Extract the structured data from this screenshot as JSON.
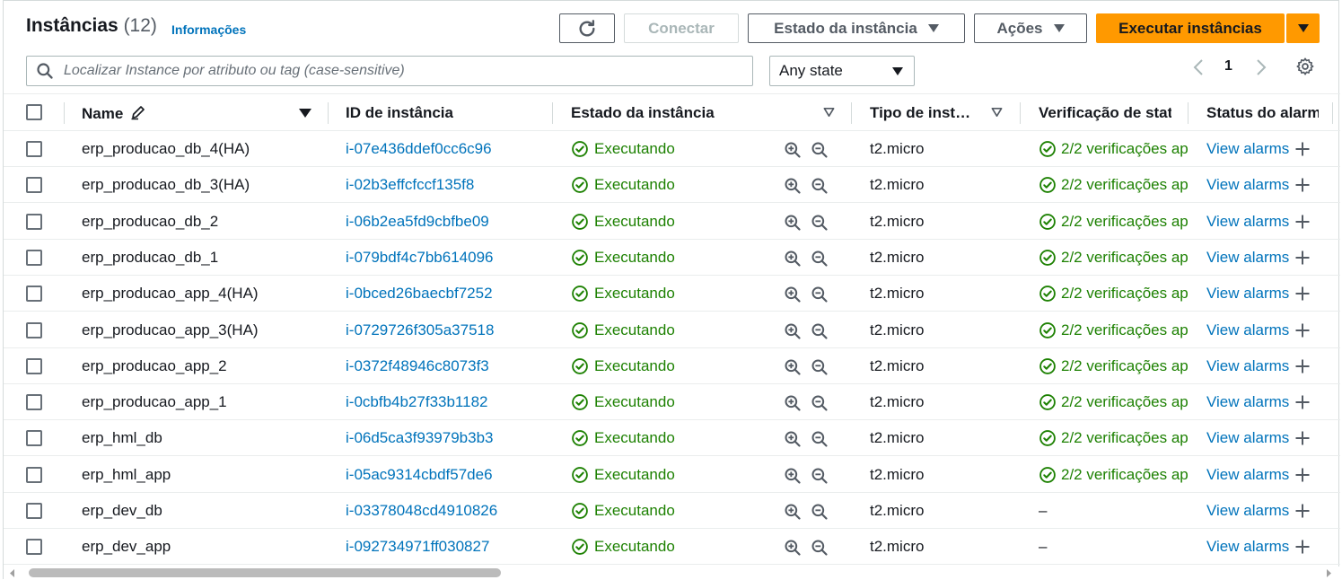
{
  "header": {
    "title": "Instâncias",
    "count": "(12)",
    "info_link": "Informações",
    "connect_label": "Conectar",
    "instance_state_label": "Estado da instância",
    "actions_label": "Ações",
    "launch_label": "Executar instâncias"
  },
  "search": {
    "placeholder": "Localizar Instance por atributo ou tag (case-sensitive)"
  },
  "state_filter": {
    "selected": "Any state"
  },
  "pagination": {
    "current_page": "1"
  },
  "columns": {
    "name": "Name",
    "id": "ID de instância",
    "state": "Estado da instância",
    "type": "Tipo de inst…",
    "check": "Verificação de stat",
    "alarm": "Status do alarm"
  },
  "icons": {
    "refresh": "refresh-icon",
    "search": "search-icon",
    "settings": "gear-icon",
    "edit": "pencil-icon",
    "running": "check-circle-icon",
    "zoom_in": "zoom-in-icon",
    "zoom_out": "zoom-out-icon",
    "add": "plus-icon"
  },
  "colors": {
    "primary": "#ff9900",
    "link": "#0073bb",
    "success": "#1d8102"
  },
  "rows": [
    {
      "name": "erp_producao_db_4(HA)",
      "id": "i-07e436ddef0cc6c96",
      "state": "Executando",
      "type": "t2.micro",
      "check": "2/2 verificações ap",
      "alarm": "View alarms"
    },
    {
      "name": "erp_producao_db_3(HA)",
      "id": "i-02b3effcfccf135f8",
      "state": "Executando",
      "type": "t2.micro",
      "check": "2/2 verificações ap",
      "alarm": "View alarms"
    },
    {
      "name": "erp_producao_db_2",
      "id": "i-06b2ea5fd9cbfbe09",
      "state": "Executando",
      "type": "t2.micro",
      "check": "2/2 verificações ap",
      "alarm": "View alarms"
    },
    {
      "name": "erp_producao_db_1",
      "id": "i-079bdf4c7bb614096",
      "state": "Executando",
      "type": "t2.micro",
      "check": "2/2 verificações ap",
      "alarm": "View alarms"
    },
    {
      "name": "erp_producao_app_4(HA)",
      "id": "i-0bced26baecbf7252",
      "state": "Executando",
      "type": "t2.micro",
      "check": "2/2 verificações ap",
      "alarm": "View alarms"
    },
    {
      "name": "erp_producao_app_3(HA)",
      "id": "i-0729726f305a37518",
      "state": "Executando",
      "type": "t2.micro",
      "check": "2/2 verificações ap",
      "alarm": "View alarms"
    },
    {
      "name": "erp_producao_app_2",
      "id": "i-0372f48946c8073f3",
      "state": "Executando",
      "type": "t2.micro",
      "check": "2/2 verificações ap",
      "alarm": "View alarms"
    },
    {
      "name": "erp_producao_app_1",
      "id": "i-0cbfb4b27f33b1182",
      "state": "Executando",
      "type": "t2.micro",
      "check": "2/2 verificações ap",
      "alarm": "View alarms"
    },
    {
      "name": "erp_hml_db",
      "id": "i-06d5ca3f93979b3b3",
      "state": "Executando",
      "type": "t2.micro",
      "check": "2/2 verificações ap",
      "alarm": "View alarms"
    },
    {
      "name": "erp_hml_app",
      "id": "i-05ac9314cbdf57de6",
      "state": "Executando",
      "type": "t2.micro",
      "check": "2/2 verificações ap",
      "alarm": "View alarms"
    },
    {
      "name": "erp_dev_db",
      "id": "i-03378048cd4910826",
      "state": "Executando",
      "type": "t2.micro",
      "check": "–",
      "alarm": "View alarms"
    },
    {
      "name": "erp_dev_app",
      "id": "i-092734971ff030827",
      "state": "Executando",
      "type": "t2.micro",
      "check": "–",
      "alarm": "View alarms"
    }
  ]
}
